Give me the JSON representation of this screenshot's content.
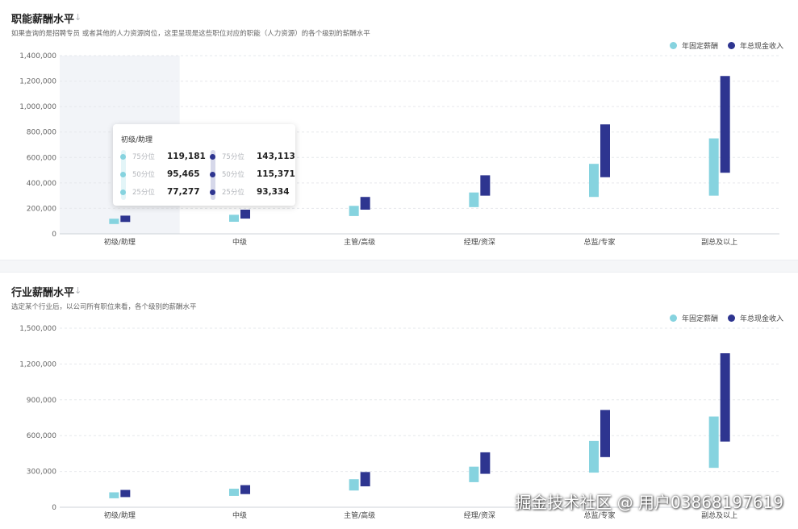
{
  "colors": {
    "fixed": "#86d3df",
    "total": "#2e3590",
    "grid": "#e6e8ec",
    "axis_text": "#666666",
    "highlight": "#f2f4f8"
  },
  "legend": {
    "fixed_label": "年固定薪酬",
    "total_label": "年总现金收入"
  },
  "section1": {
    "title": "职能薪酬水平",
    "sort_icon": "↓",
    "description": "如果查询的是招聘专员 或者其他的人力资源岗位，这里呈现是这些职位对应的职能（人力资源）的各个级别的薪酬水平"
  },
  "section2": {
    "title": "行业薪酬水平",
    "sort_icon": "↓",
    "description": "选定某个行业后，以公司所有职位来看，各个级别的薪酬水平"
  },
  "tooltip": {
    "title": "初级/助理",
    "rows": [
      {
        "label": "75分位",
        "fixed": "119,181",
        "total": "143,113"
      },
      {
        "label": "50分位",
        "fixed": "95,465",
        "total": "115,371"
      },
      {
        "label": "25分位",
        "fixed": "77,277",
        "total": "93,334"
      }
    ]
  },
  "watermark": "掘金技术社区 @ 用户03868197619",
  "chart_data": [
    {
      "type": "bar",
      "title": "职能薪酬水平",
      "subtype": "floating-range",
      "categories": [
        "初级/助理",
        "中级",
        "主管/高级",
        "经理/资深",
        "总监/专家",
        "副总及以上"
      ],
      "ylim": [
        0,
        1400000
      ],
      "yticks": [
        "0",
        "200,000",
        "400,000",
        "600,000",
        "800,000",
        "1,000,000",
        "1,200,000",
        "1,400,000"
      ],
      "ytick_values": [
        0,
        200000,
        400000,
        600000,
        800000,
        1000000,
        1200000,
        1400000
      ],
      "grid": true,
      "legend_position": "top-right",
      "highlighted_category": "初级/助理",
      "series": [
        {
          "name": "年固定薪酬",
          "low": [
            77277,
            95000,
            140000,
            210000,
            290000,
            300000
          ],
          "high": [
            119181,
            150000,
            220000,
            325000,
            550000,
            750000
          ]
        },
        {
          "name": "年总现金收入",
          "low": [
            93334,
            120000,
            190000,
            300000,
            445000,
            480000
          ],
          "high": [
            143113,
            190000,
            290000,
            460000,
            860000,
            1240000
          ]
        }
      ]
    },
    {
      "type": "bar",
      "title": "行业薪酬水平",
      "subtype": "floating-range",
      "categories": [
        "初级/助理",
        "中级",
        "主管/高级",
        "经理/资深",
        "总监/专家",
        "副总及以上"
      ],
      "ylim": [
        0,
        1500000
      ],
      "yticks": [
        "0",
        "300,000",
        "600,000",
        "900,000",
        "1,200,000",
        "1,500,000"
      ],
      "ytick_values": [
        0,
        300000,
        600000,
        900000,
        1200000,
        1500000
      ],
      "grid": true,
      "legend_position": "top-right",
      "series": [
        {
          "name": "年固定薪酬",
          "low": [
            75000,
            95000,
            140000,
            210000,
            290000,
            330000
          ],
          "high": [
            125000,
            155000,
            235000,
            340000,
            555000,
            760000
          ]
        },
        {
          "name": "年总现金收入",
          "low": [
            85000,
            110000,
            175000,
            280000,
            420000,
            550000
          ],
          "high": [
            145000,
            185000,
            295000,
            460000,
            815000,
            1290000
          ]
        }
      ]
    }
  ]
}
